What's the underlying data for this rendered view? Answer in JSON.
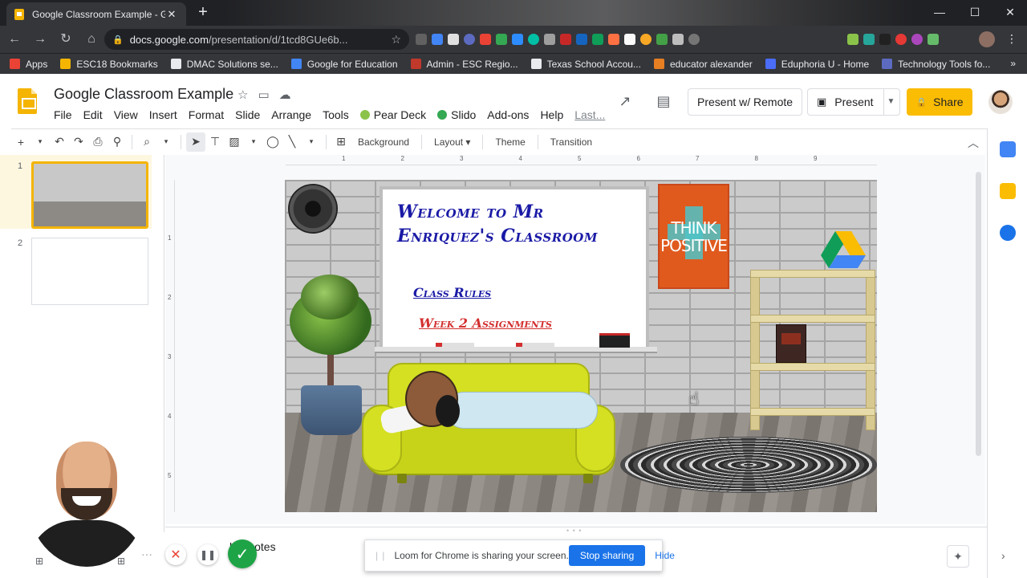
{
  "browser": {
    "tab": {
      "title": "Google Classroom Example - Go",
      "close": "✕"
    },
    "new_tab": "+",
    "window_controls": {
      "minimize": "—",
      "maximize": "☐",
      "close": "✕"
    },
    "nav": {
      "back": "←",
      "forward": "→",
      "reload": "↻",
      "home": "⌂"
    },
    "url": {
      "host": "docs.google.com",
      "path": "/presentation/d/1tcd8GUe6b..."
    },
    "menu": "⋮",
    "bookmarks": [
      {
        "label": "Apps",
        "color": "#ea4335"
      },
      {
        "label": "ESC18 Bookmarks",
        "color": "#f4b400"
      },
      {
        "label": "DMAC Solutions se...",
        "color": "#e8eaed"
      },
      {
        "label": "Google for Education",
        "color": "#4285f4"
      },
      {
        "label": "Admin - ESC Regio...",
        "color": "#c0392b"
      },
      {
        "label": "Texas School Accou...",
        "color": "#e8eaed"
      },
      {
        "label": "educator alexander",
        "color": "#e67e22"
      },
      {
        "label": "Eduphoria U - Home",
        "color": "#4a6cf7"
      },
      {
        "label": "Technology Tools fo...",
        "color": "#5c6bc0"
      }
    ],
    "bookmarks_more": "»"
  },
  "app": {
    "title": "Google Classroom Example",
    "menu": [
      "File",
      "Edit",
      "View",
      "Insert",
      "Format",
      "Slide",
      "Arrange",
      "Tools"
    ],
    "addons_menu": [
      {
        "label": "Pear Deck",
        "color": "#8bc34a"
      },
      {
        "label": "Slido",
        "color": "#34a853"
      }
    ],
    "menu_tail": [
      "Add-ons",
      "Help"
    ],
    "last_edit": "Last...",
    "present_remote": "Present w/ Remote",
    "present": "Present",
    "share": "Share",
    "brand_color": "#fbbc04"
  },
  "toolbar": {
    "background": "Background",
    "layout": "Layout",
    "theme": "Theme",
    "transition": "Transition"
  },
  "filmstrip": {
    "slides": [
      "1",
      "2"
    ]
  },
  "rulers": {
    "top": [
      "1",
      "2",
      "3",
      "4",
      "5",
      "6",
      "7",
      "8",
      "9"
    ],
    "left": [
      "1",
      "2",
      "3",
      "4",
      "5"
    ]
  },
  "slide": {
    "title_line1": "Welcome to Mr",
    "title_line2": "Enriquez's Classroom",
    "link_rules": "Class Rules",
    "link_rules_color": "#1a1aa6",
    "link_week": "Week 2 Assignments",
    "link_week_color": "#d32f2f",
    "poster_line1": "THINK",
    "poster_line2": "POSITIVE"
  },
  "notes": {
    "label": "ker notes"
  },
  "loom": {
    "message": "Loom for Chrome is sharing your screen.",
    "stop": "Stop sharing",
    "hide": "Hide",
    "more": "···",
    "cancel": "✕",
    "pause": "❚❚",
    "done": "✓"
  }
}
